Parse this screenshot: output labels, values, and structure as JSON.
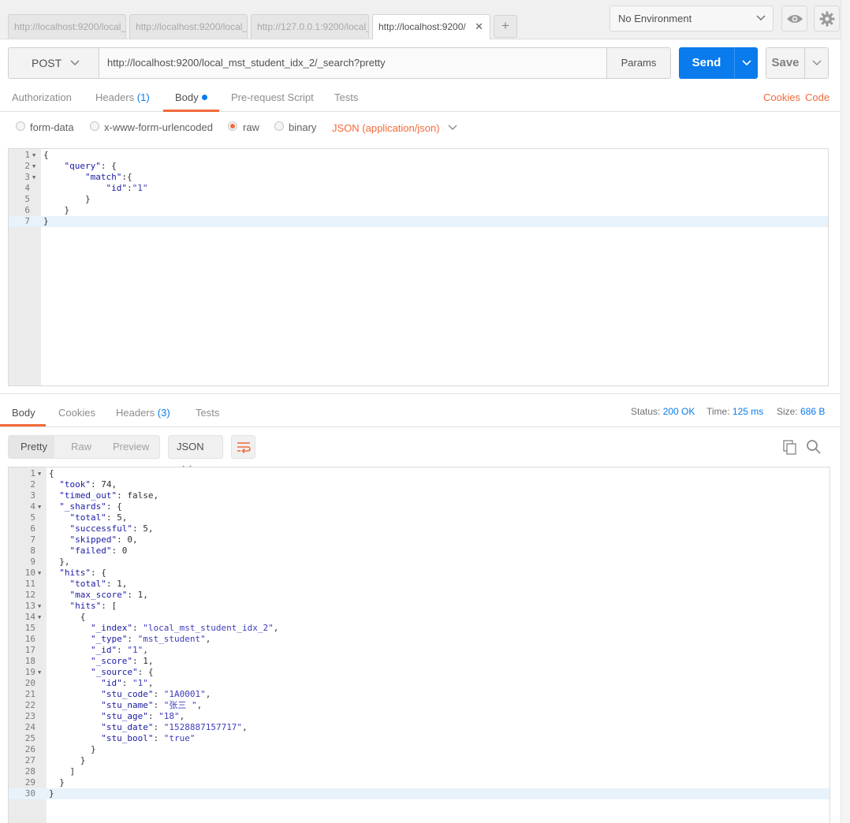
{
  "tabs": [
    {
      "label": "http://localhost:9200/local_",
      "active": false
    },
    {
      "label": "http://localhost:9200/local_",
      "active": false
    },
    {
      "label": "http://127.0.0.1:9200/local_",
      "active": false
    },
    {
      "label": "http://localhost:9200/",
      "active": true
    }
  ],
  "tab_close": "✕",
  "tab_add": "+",
  "environment": {
    "selected": "No Environment"
  },
  "request": {
    "method": "POST",
    "url": "http://localhost:9200/local_mst_student_idx_2/_search?pretty",
    "params_label": "Params",
    "send_label": "Send",
    "save_label": "Save"
  },
  "request_tabs": {
    "authorization": "Authorization",
    "headers": "Headers",
    "headers_count": "(1)",
    "body": "Body",
    "prerequest": "Pre-request Script",
    "tests": "Tests",
    "cookies": "Cookies",
    "code": "Code"
  },
  "body_types": {
    "form_data": "form-data",
    "urlencoded": "x-www-form-urlencoded",
    "raw": "raw",
    "binary": "binary",
    "selected": "raw",
    "content_type": "JSON (application/json)"
  },
  "request_body_lines": [
    {
      "n": "1",
      "fold": true,
      "text": "{"
    },
    {
      "n": "2",
      "fold": true,
      "text": "    \"query\": {"
    },
    {
      "n": "3",
      "fold": true,
      "text": "        \"match\":{"
    },
    {
      "n": "4",
      "fold": false,
      "text": "            \"id\":\"1\""
    },
    {
      "n": "5",
      "fold": false,
      "text": "        }"
    },
    {
      "n": "6",
      "fold": false,
      "text": "    }"
    },
    {
      "n": "7",
      "fold": false,
      "text": "}"
    }
  ],
  "response_tabs": {
    "body": "Body",
    "cookies": "Cookies",
    "headers": "Headers",
    "headers_count": "(3)",
    "tests": "Tests"
  },
  "response_meta": {
    "status_label": "Status:",
    "status_value": "200 OK",
    "time_label": "Time:",
    "time_value": "125 ms",
    "size_label": "Size:",
    "size_value": "686 B"
  },
  "view_modes": {
    "pretty": "Pretty",
    "raw": "Raw",
    "preview": "Preview",
    "format": "JSON"
  },
  "response_body_lines": [
    {
      "n": "1",
      "fold": true,
      "text": "{"
    },
    {
      "n": "2",
      "fold": false,
      "text": "  \"took\": 74,"
    },
    {
      "n": "3",
      "fold": false,
      "text": "  \"timed_out\": false,"
    },
    {
      "n": "4",
      "fold": true,
      "text": "  \"_shards\": {"
    },
    {
      "n": "5",
      "fold": false,
      "text": "    \"total\": 5,"
    },
    {
      "n": "6",
      "fold": false,
      "text": "    \"successful\": 5,"
    },
    {
      "n": "7",
      "fold": false,
      "text": "    \"skipped\": 0,"
    },
    {
      "n": "8",
      "fold": false,
      "text": "    \"failed\": 0"
    },
    {
      "n": "9",
      "fold": false,
      "text": "  },"
    },
    {
      "n": "10",
      "fold": true,
      "text": "  \"hits\": {"
    },
    {
      "n": "11",
      "fold": false,
      "text": "    \"total\": 1,"
    },
    {
      "n": "12",
      "fold": false,
      "text": "    \"max_score\": 1,"
    },
    {
      "n": "13",
      "fold": true,
      "text": "    \"hits\": ["
    },
    {
      "n": "14",
      "fold": true,
      "text": "      {"
    },
    {
      "n": "15",
      "fold": false,
      "text": "        \"_index\": \"local_mst_student_idx_2\","
    },
    {
      "n": "16",
      "fold": false,
      "text": "        \"_type\": \"mst_student\","
    },
    {
      "n": "17",
      "fold": false,
      "text": "        \"_id\": \"1\","
    },
    {
      "n": "18",
      "fold": false,
      "text": "        \"_score\": 1,"
    },
    {
      "n": "19",
      "fold": true,
      "text": "        \"_source\": {"
    },
    {
      "n": "20",
      "fold": false,
      "text": "          \"id\": \"1\","
    },
    {
      "n": "21",
      "fold": false,
      "text": "          \"stu_code\": \"1A0001\","
    },
    {
      "n": "22",
      "fold": false,
      "text": "          \"stu_name\": \"张三 \","
    },
    {
      "n": "23",
      "fold": false,
      "text": "          \"stu_age\": \"18\","
    },
    {
      "n": "24",
      "fold": false,
      "text": "          \"stu_date\": \"1528887157717\","
    },
    {
      "n": "25",
      "fold": false,
      "text": "          \"stu_bool\": \"true\""
    },
    {
      "n": "26",
      "fold": false,
      "text": "        }"
    },
    {
      "n": "27",
      "fold": false,
      "text": "      }"
    },
    {
      "n": "28",
      "fold": false,
      "text": "    ]"
    },
    {
      "n": "29",
      "fold": false,
      "text": "  }"
    },
    {
      "n": "30",
      "fold": false,
      "text": "}"
    }
  ],
  "icons": [
    "eye-icon",
    "gear-icon",
    "chevron-down-icon",
    "wrap-lines-icon",
    "copy-icon",
    "search-icon"
  ],
  "colors": {
    "accent": "#f26b3a",
    "primary": "#097bed"
  }
}
